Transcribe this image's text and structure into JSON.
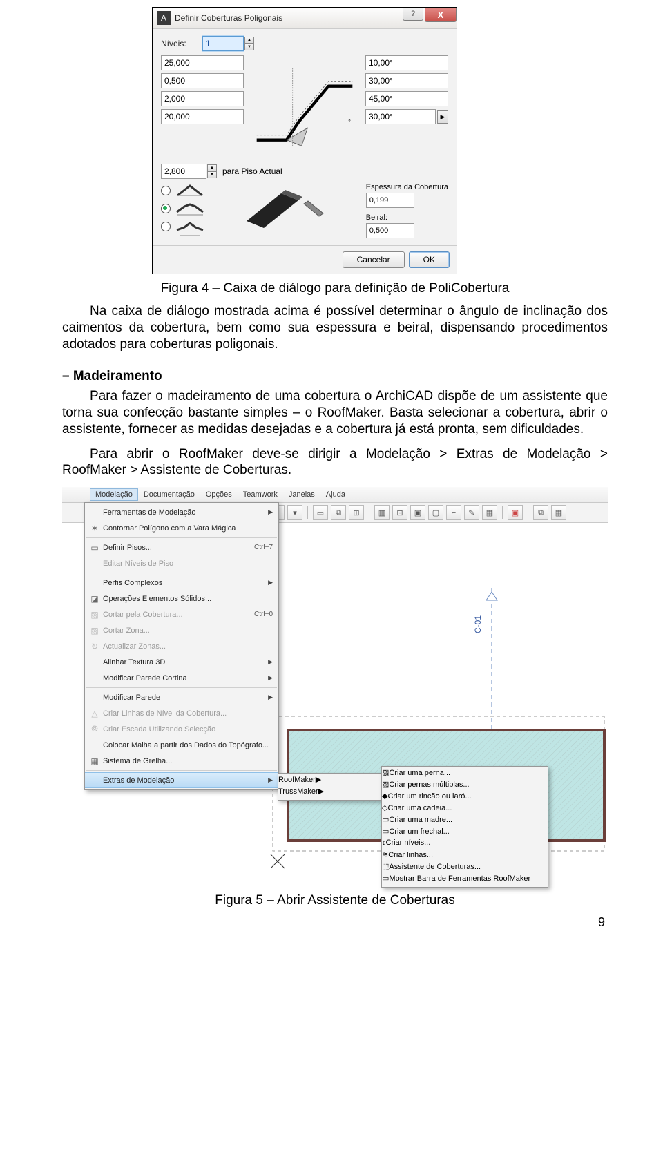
{
  "dlg1": {
    "title": "Definir Coberturas Poligonais",
    "help_glyph": "?",
    "close_glyph": "X",
    "niveis_label": "Níveis:",
    "niveis_value": "1",
    "left_vals": [
      "25,000",
      "0,500",
      "2,000",
      "20,000"
    ],
    "right_vals": [
      "10,00°",
      "30,00°",
      "45,00°",
      "30,00°"
    ],
    "level_val": "2,800",
    "level_label": "para Piso Actual",
    "espessura_label": "Espessura da Cobertura",
    "espessura_val": "0,199",
    "beiral_label": "Beiral:",
    "beiral_val": "0,500",
    "cancel": "Cancelar",
    "ok": "OK"
  },
  "article": {
    "fig4_caption": "Figura 4 – Caixa de diálogo para definição de PoliCobertura",
    "p1": "Na caixa de diálogo mostrada acima é possível determinar o ângulo de inclinação dos caimentos da cobertura, bem como sua espessura e beiral, dispensando procedimentos adotados para coberturas poligonais.",
    "heading": "– Madeiramento",
    "p2": "Para fazer o madeiramento de uma cobertura o ArchiCAD dispõe de um assistente que torna sua confecção bastante simples – o RoofMaker. Basta selecionar a cobertura, abrir o assistente, fornecer as medidas desejadas e a cobertura já está pronta, sem dificuldades.",
    "p3": "Para abrir o RoofMaker deve-se dirigir a Modelação > Extras de Modelação > RoofMaker > Assistente de Coberturas.",
    "fig5_caption": "Figura 5 – Abrir Assistente de Coberturas",
    "page_number": "9"
  },
  "ac": {
    "menubar": [
      "Modelação",
      "Documentação",
      "Opções",
      "Teamwork",
      "Janelas",
      "Ajuda"
    ],
    "menu": [
      {
        "icon": "",
        "label": "Ferramentas de Modelação",
        "arrow": true
      },
      {
        "icon": "✶",
        "label": "Contornar Polígono com a Vara Mágica"
      },
      {
        "sep": true
      },
      {
        "icon": "▭",
        "label": "Definir Pisos...",
        "short": "Ctrl+7"
      },
      {
        "icon": "",
        "label": "Editar Níveis de Piso",
        "disabled": true
      },
      {
        "sep": true
      },
      {
        "icon": "",
        "label": "Perfis Complexos",
        "arrow": true
      },
      {
        "icon": "◪",
        "label": "Operações Elementos Sólidos..."
      },
      {
        "icon": "▧",
        "label": "Cortar pela Cobertura...",
        "short": "Ctrl+0",
        "disabled": true
      },
      {
        "icon": "▧",
        "label": "Cortar Zona...",
        "disabled": true
      },
      {
        "icon": "↻",
        "label": "Actualizar Zonas...",
        "disabled": true
      },
      {
        "icon": "",
        "label": "Alinhar Textura 3D",
        "arrow": true
      },
      {
        "icon": "",
        "label": "Modificar Parede Cortina",
        "arrow": true
      },
      {
        "sep": true
      },
      {
        "icon": "",
        "label": "Modificar Parede",
        "arrow": true
      },
      {
        "icon": "△",
        "label": "Criar Linhas de Nível da Cobertura...",
        "disabled": true
      },
      {
        "icon": "⦾",
        "label": "Criar Escada Utilizando Selecção",
        "disabled": true
      },
      {
        "icon": "",
        "label": "Colocar Malha a partir dos Dados do Topógrafo..."
      },
      {
        "icon": "▦",
        "label": "Sistema de Grelha..."
      },
      {
        "sep": true
      },
      {
        "icon": "",
        "label": "Extras de Modelação",
        "arrow": true,
        "hover": true
      }
    ],
    "menu2": [
      {
        "label": "RoofMaker",
        "arrow": true,
        "hover": true
      },
      {
        "label": "TrussMaker",
        "arrow": true
      }
    ],
    "menu3": [
      {
        "icon": "▨",
        "label": "Criar uma perna..."
      },
      {
        "icon": "▨",
        "label": "Criar pernas múltiplas..."
      },
      {
        "icon": "◆",
        "label": "Criar um rincão ou laró..."
      },
      {
        "icon": "◇",
        "label": "Criar uma cadeia..."
      },
      {
        "icon": "▭",
        "label": "Criar uma madre..."
      },
      {
        "icon": "▭",
        "label": "Criar um frechal..."
      },
      {
        "icon": "↕",
        "label": "Criar níveis..."
      },
      {
        "icon": "≋",
        "label": "Criar linhas..."
      },
      {
        "sep": true
      },
      {
        "icon": "⬚",
        "label": "Assistente de Coberturas...",
        "hover": true
      },
      {
        "sep": true
      },
      {
        "icon": "▭",
        "label": "Mostrar Barra de Ferramentas RoofMaker"
      }
    ],
    "marker_label": "C-01"
  }
}
